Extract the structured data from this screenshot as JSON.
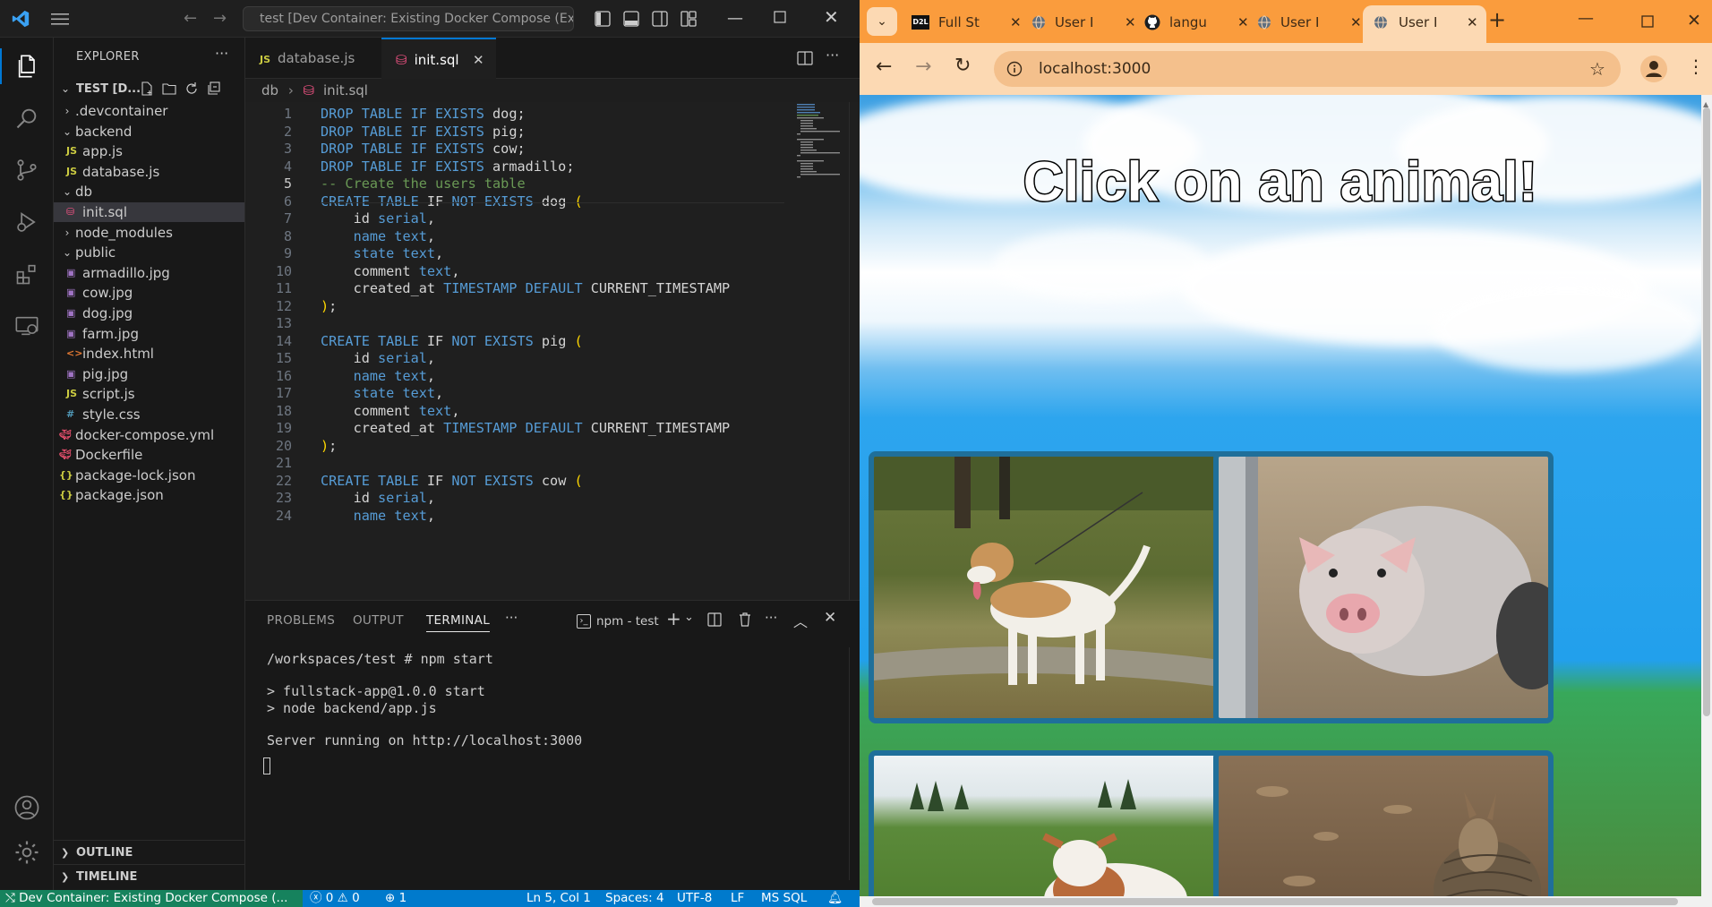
{
  "vscode": {
    "title": "test [Dev Container: Existing Docker Compose (Extend)]",
    "explorer_label": "EXPLORER",
    "folder_label": "TEST [D...",
    "tree": [
      {
        "label": ".devcontainer",
        "kind": "folder-closed",
        "depth": 1
      },
      {
        "label": "backend",
        "kind": "folder-open",
        "depth": 1
      },
      {
        "label": "app.js",
        "kind": "js",
        "depth": 2
      },
      {
        "label": "database.js",
        "kind": "js",
        "depth": 2
      },
      {
        "label": "db",
        "kind": "folder-open",
        "depth": 1
      },
      {
        "label": "init.sql",
        "kind": "sql",
        "depth": 2,
        "selected": true
      },
      {
        "label": "node_modules",
        "kind": "folder-closed",
        "depth": 1
      },
      {
        "label": "public",
        "kind": "folder-open",
        "depth": 1
      },
      {
        "label": "armadillo.jpg",
        "kind": "img",
        "depth": 2
      },
      {
        "label": "cow.jpg",
        "kind": "img",
        "depth": 2
      },
      {
        "label": "dog.jpg",
        "kind": "img",
        "depth": 2
      },
      {
        "label": "farm.jpg",
        "kind": "img",
        "depth": 2
      },
      {
        "label": "index.html",
        "kind": "html",
        "depth": 2
      },
      {
        "label": "pig.jpg",
        "kind": "img",
        "depth": 2
      },
      {
        "label": "script.js",
        "kind": "js",
        "depth": 2
      },
      {
        "label": "style.css",
        "kind": "css",
        "depth": 2
      },
      {
        "label": "docker-compose.yml",
        "kind": "docker",
        "depth": 1
      },
      {
        "label": "Dockerfile",
        "kind": "docker",
        "depth": 1
      },
      {
        "label": "package-lock.json",
        "kind": "json",
        "depth": 1
      },
      {
        "label": "package.json",
        "kind": "json",
        "depth": 1
      }
    ],
    "outline_label": "OUTLINE",
    "timeline_label": "TIMELINE",
    "tabs": [
      {
        "label": "database.js",
        "icon": "JS",
        "active": false
      },
      {
        "label": "init.sql",
        "icon": "sql",
        "active": true
      }
    ],
    "breadcrumb": {
      "folder": "db",
      "file": "init.sql"
    },
    "code_lines": [
      [
        [
          "kw",
          "DROP TABLE IF EXISTS "
        ],
        [
          "tx",
          "dog;"
        ]
      ],
      [
        [
          "kw",
          "DROP TABLE IF EXISTS "
        ],
        [
          "tx",
          "pig;"
        ]
      ],
      [
        [
          "kw",
          "DROP TABLE IF EXISTS "
        ],
        [
          "tx",
          "cow;"
        ]
      ],
      [
        [
          "kw",
          "DROP TABLE IF EXISTS "
        ],
        [
          "tx",
          "armadillo;"
        ]
      ],
      [
        [
          "cm",
          "-- Create the users table"
        ]
      ],
      [
        [
          "kw",
          "CREATE TABLE "
        ],
        [
          "tx",
          "IF "
        ],
        [
          "kw",
          "NOT EXISTS "
        ],
        [
          "tx",
          "dog "
        ],
        [
          "pn",
          "("
        ]
      ],
      [
        [
          "tx",
          "    id "
        ],
        [
          "kw",
          "serial"
        ],
        [
          "tx",
          ","
        ]
      ],
      [
        [
          "tx",
          "    "
        ],
        [
          "kw",
          "name text"
        ],
        [
          "tx",
          ","
        ]
      ],
      [
        [
          "tx",
          "    "
        ],
        [
          "kw",
          "state text"
        ],
        [
          "tx",
          ","
        ]
      ],
      [
        [
          "tx",
          "    comment "
        ],
        [
          "kw",
          "text"
        ],
        [
          "tx",
          ","
        ]
      ],
      [
        [
          "tx",
          "    created_at "
        ],
        [
          "kw",
          "TIMESTAMP DEFAULT "
        ],
        [
          "tx",
          "CURRENT_TIMESTAMP"
        ]
      ],
      [
        [
          "pn",
          ")"
        ],
        [
          "tx",
          ";"
        ]
      ],
      [],
      [
        [
          "kw",
          "CREATE TABLE "
        ],
        [
          "tx",
          "IF "
        ],
        [
          "kw",
          "NOT EXISTS "
        ],
        [
          "tx",
          "pig "
        ],
        [
          "pn",
          "("
        ]
      ],
      [
        [
          "tx",
          "    id "
        ],
        [
          "kw",
          "serial"
        ],
        [
          "tx",
          ","
        ]
      ],
      [
        [
          "tx",
          "    "
        ],
        [
          "kw",
          "name text"
        ],
        [
          "tx",
          ","
        ]
      ],
      [
        [
          "tx",
          "    "
        ],
        [
          "kw",
          "state text"
        ],
        [
          "tx",
          ","
        ]
      ],
      [
        [
          "tx",
          "    comment "
        ],
        [
          "kw",
          "text"
        ],
        [
          "tx",
          ","
        ]
      ],
      [
        [
          "tx",
          "    created_at "
        ],
        [
          "kw",
          "TIMESTAMP DEFAULT "
        ],
        [
          "tx",
          "CURRENT_TIMESTAMP"
        ]
      ],
      [
        [
          "pn",
          ")"
        ],
        [
          "tx",
          ";"
        ]
      ],
      [],
      [
        [
          "kw",
          "CREATE TABLE "
        ],
        [
          "tx",
          "IF "
        ],
        [
          "kw",
          "NOT EXISTS "
        ],
        [
          "tx",
          "cow "
        ],
        [
          "pn",
          "("
        ]
      ],
      [
        [
          "tx",
          "    id "
        ],
        [
          "kw",
          "serial"
        ],
        [
          "tx",
          ","
        ]
      ],
      [
        [
          "tx",
          "    "
        ],
        [
          "kw",
          "name text"
        ],
        [
          "tx",
          ","
        ]
      ]
    ],
    "panel_tabs": [
      "PROBLEMS",
      "OUTPUT",
      "TERMINAL"
    ],
    "terminal_name": "npm - test",
    "terminal_lines": [
      "/workspaces/test # npm start",
      "",
      "> fullstack-app@1.0.0 start",
      "> node backend/app.js",
      "",
      "Server running on http://localhost:3000"
    ],
    "status": {
      "remote": "Dev Container: Existing Docker Compose (...",
      "errors": "0",
      "warnings": "0",
      "ports": "1",
      "position": "Ln 5, Col 1",
      "spaces": "Spaces: 4",
      "encoding": "UTF-8",
      "eol": "LF",
      "language": "MS SQL"
    }
  },
  "chrome": {
    "tabs": [
      {
        "label": "Full St",
        "icon": "D2L"
      },
      {
        "label": "User I",
        "icon": "globe"
      },
      {
        "label": "langu",
        "icon": "github"
      },
      {
        "label": "User I",
        "icon": "globe"
      },
      {
        "label": "User I",
        "icon": "globe",
        "active": true
      }
    ],
    "url": "localhost:3000",
    "page_heading": "Click on an animal!",
    "animals": [
      "dog",
      "pig",
      "cow",
      "armadillo"
    ],
    "colors": {
      "tab_strip": "#fa9c3d",
      "toolbar": "#fcd9b3",
      "vscode_accent": "#007acc",
      "remote_green": "#16825d"
    }
  }
}
